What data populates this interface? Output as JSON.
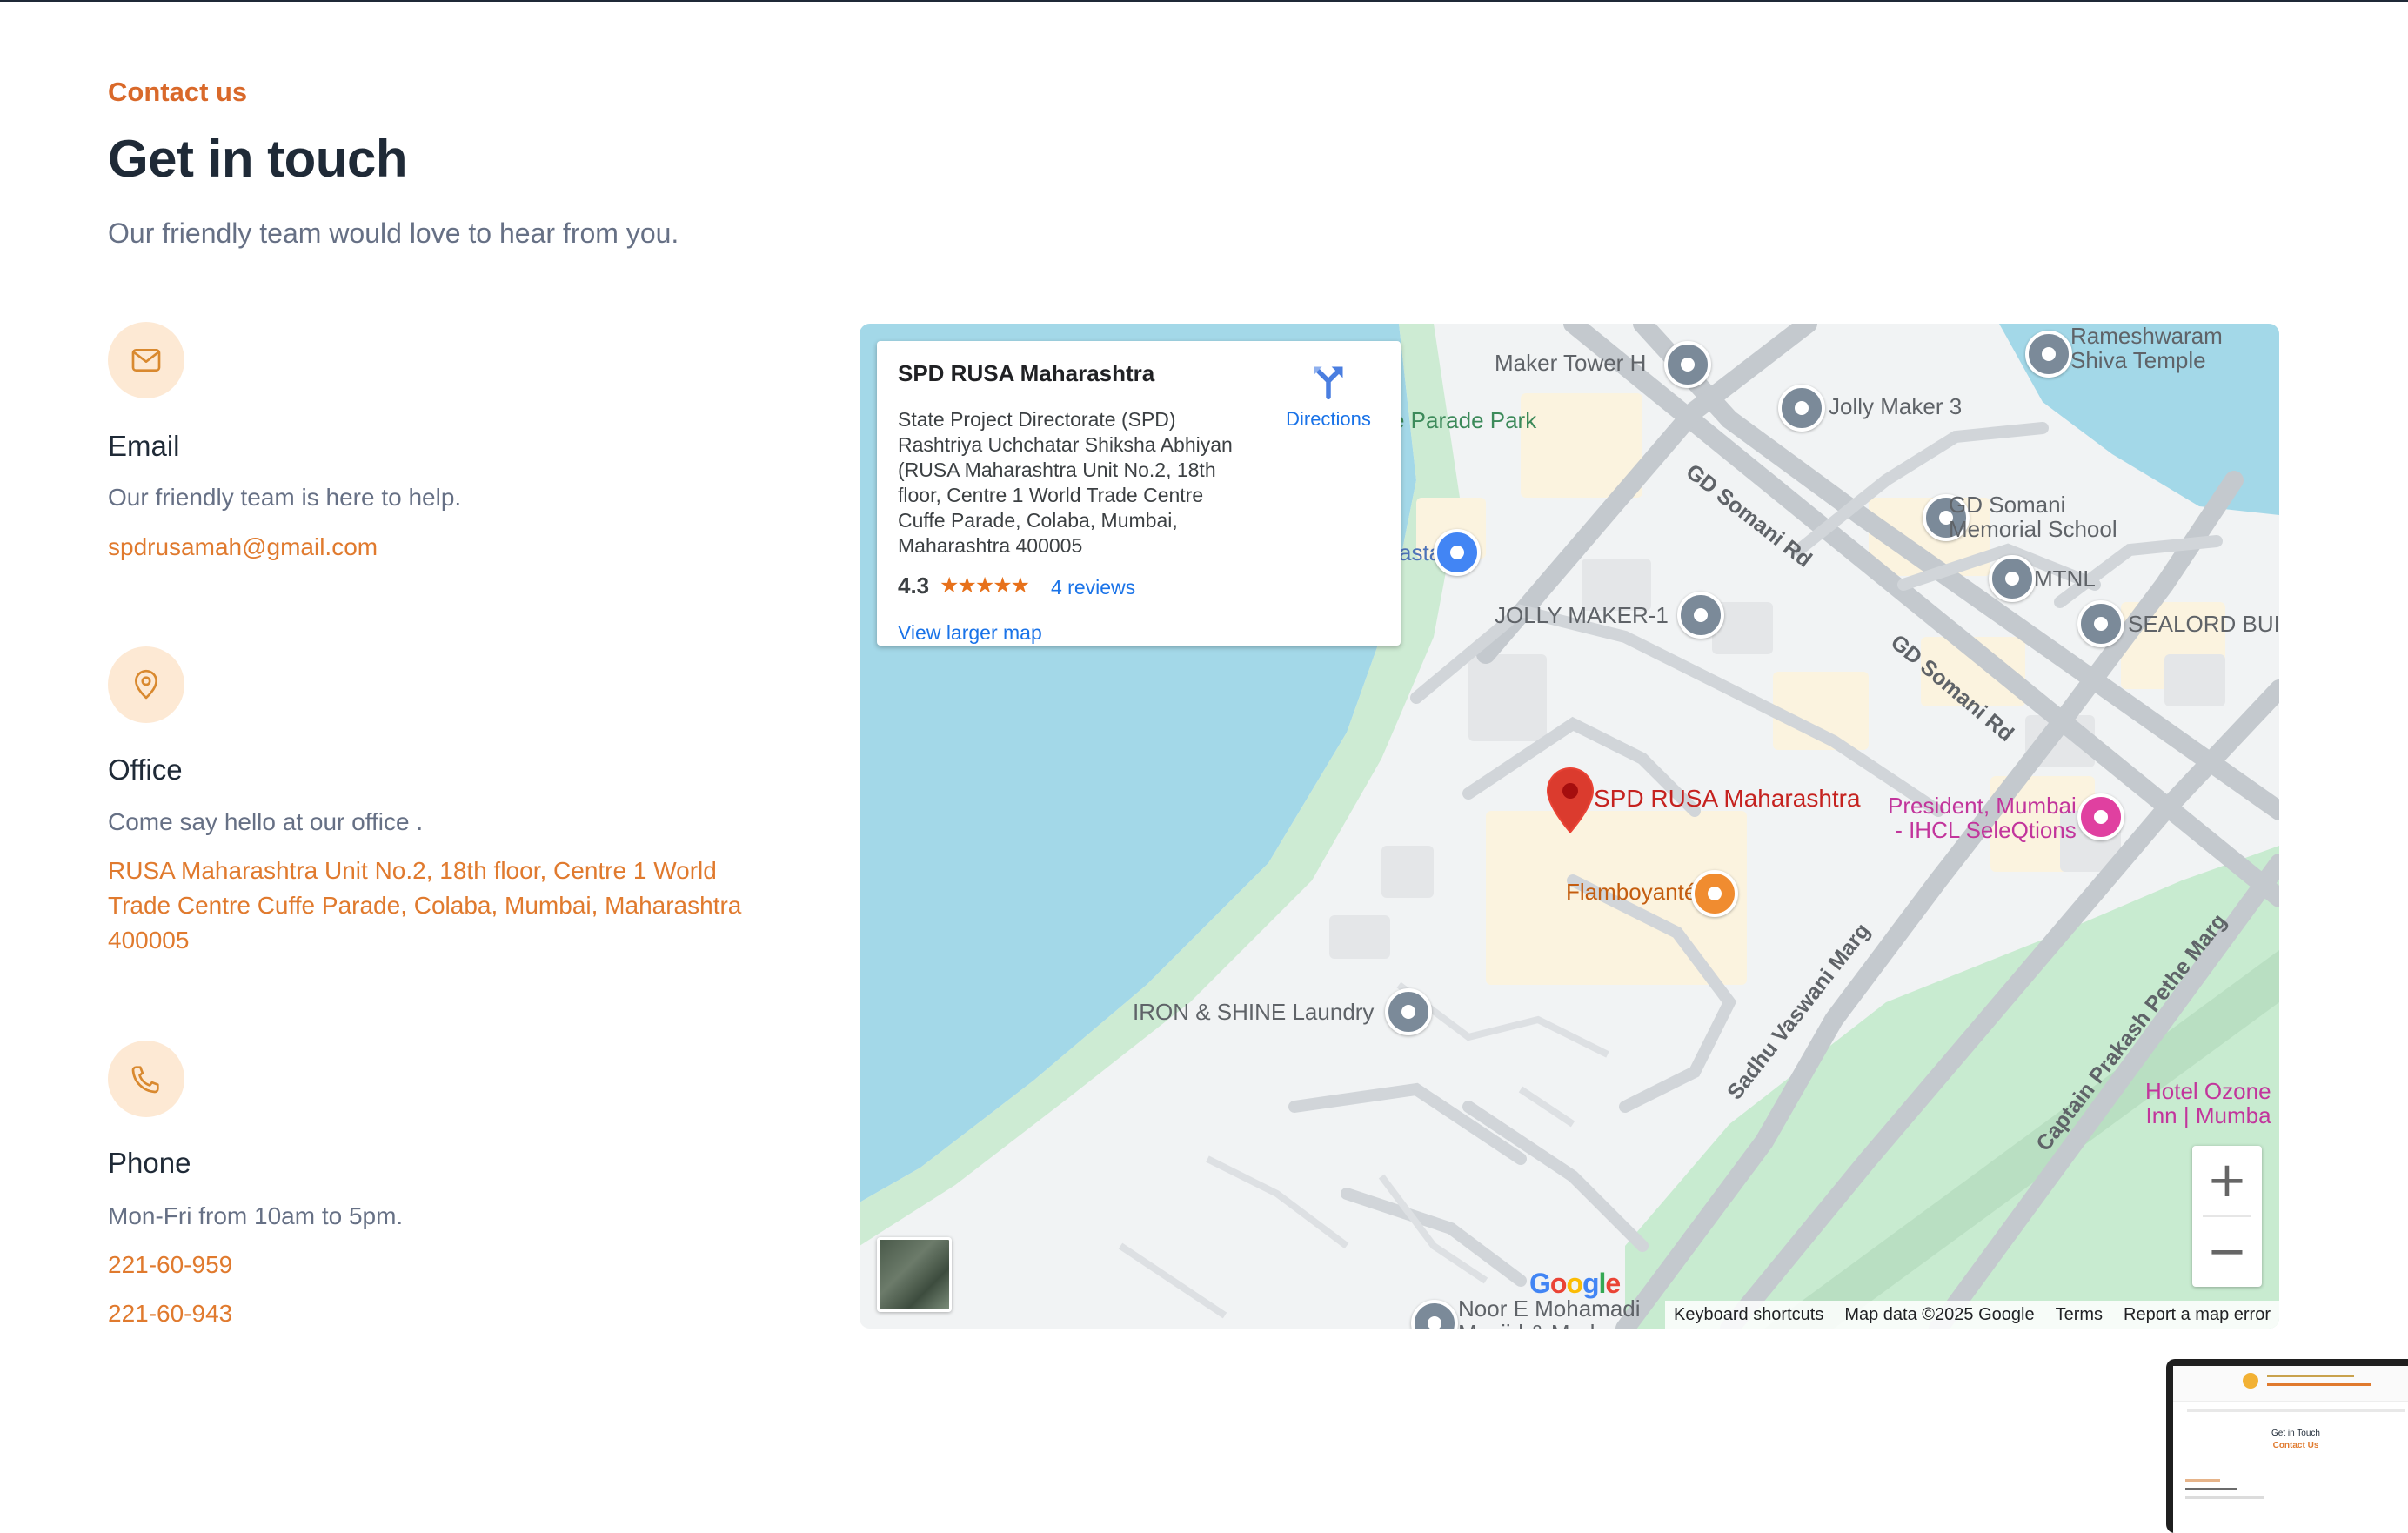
{
  "header": {
    "eyebrow": "Contact us",
    "title": "Get in touch",
    "subtitle": "Our friendly team would love to hear from you."
  },
  "email": {
    "title": "Email",
    "description": "Our friendly team is here to help.",
    "address": "spdrusamah@gmail.com",
    "icon": "mail-icon"
  },
  "office": {
    "title": "Office",
    "description": "Come say hello at our office .",
    "address_lines": [
      "RUSA Maharashtra Unit No.2, 18th floor, Centre 1 World",
      "Trade Centre Cuffe Parade, Colaba, Mumbai, Maharashtra",
      "400005"
    ],
    "icon": "map-pin-icon"
  },
  "phone": {
    "title": "Phone",
    "description": "Mon-Fri from 10am to 5pm.",
    "numbers": [
      "221-60-959",
      "221-60-943"
    ],
    "icon": "phone-icon"
  },
  "map": {
    "place_card": {
      "title": "SPD RUSA Maharashtra",
      "address_lines": [
        "State Project Directorate (SPD)",
        "Rashtriya Uchchatar Shiksha Abhiyan",
        "(RUSA Maharashtra Unit No.2, 18th",
        "floor, Centre 1 World Trade Centre",
        "Cuffe Parade, Colaba, Mumbai,",
        "Maharashtra 400005"
      ],
      "rating": "4.3",
      "stars": "★★★★★",
      "reviews": "4 reviews",
      "directions": "Directions",
      "view_larger": "View larger map"
    },
    "labels": {
      "maker_tower": "Maker Tower H",
      "parade_park": "e Parade Park",
      "jolly_maker_3": "Jolly Maker 3",
      "rameshwaram_1": "Rameshwaram",
      "rameshwaram_2": "Shiva Temple",
      "gd_somani_school_1": "GD Somani",
      "gd_somani_school_2": "Memorial School",
      "mtnl": "MTNL",
      "sealord": "SEALORD BUI",
      "asta": "asta",
      "jolly_maker_1": "JOLLY MAKER-1",
      "gd_somani_rd": "GD Somani Rd",
      "spd_rusa": "SPD RUSA Maharashtra",
      "president_1": "President, Mumbai",
      "president_2": "- IHCL SeleQtions",
      "flamboyante": "Flamboyanté",
      "iron_shine": "IRON & SHINE Laundry",
      "sadhu_marg": "Sadhu Vaswani Marg",
      "captain_marg": "Captain Prakash Pethe Marg",
      "hotel_ozone_1": "Hotel Ozone",
      "hotel_ozone_2": "Inn | Mumba",
      "noor": "Noor E Mohamadi",
      "noor_2": "Masjid & Madrasa"
    },
    "zoom_in": "+",
    "zoom_out": "−",
    "google_logo": "Google",
    "attribution": {
      "keyboard": "Keyboard shortcuts",
      "mapdata": "Map data ©2025 Google",
      "terms": "Terms",
      "report": "Report a map error"
    }
  },
  "preview": {
    "title": "Get in Touch",
    "subtitle": "Contact Us"
  },
  "colors": {
    "accent": "#e07a2e",
    "heading": "#1f2a37",
    "muted": "#667085",
    "icon_bg": "#fde9d4",
    "water": "#a3d8e8",
    "park": "#c8ebd0"
  }
}
